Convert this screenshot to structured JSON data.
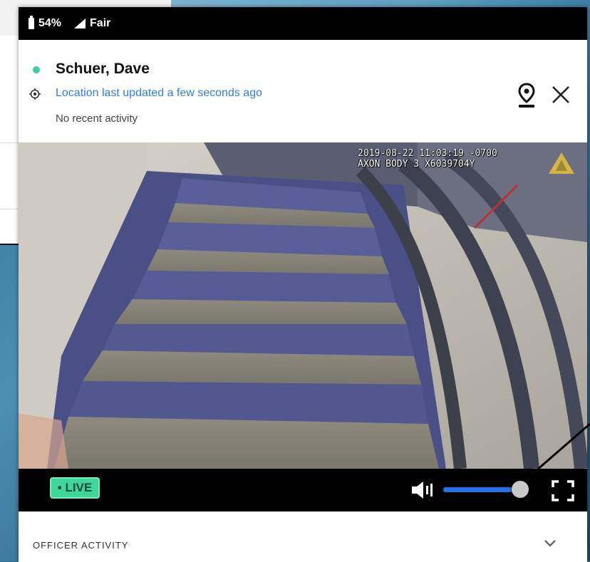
{
  "statusbar": {
    "battery": "54%",
    "signal": "Fair"
  },
  "officer": {
    "name": "Schuer, Dave",
    "location_text": "Location last updated a few seconds ago",
    "activity_text": "No recent activity",
    "status_color": "#3ccf9c"
  },
  "video": {
    "timestamp": "2019-08-22 11:03:19 -0700",
    "device": "AXON BODY 3 X6039704Y"
  },
  "controls": {
    "live_label": "• LIVE",
    "volume_level": 0.85
  },
  "activity_section": {
    "title": "OFFICER ACTIVITY"
  },
  "colors": {
    "accent": "#2273e6",
    "live": "#3fd69b",
    "link": "#2e7fe0"
  },
  "icons": [
    "battery-icon",
    "signal-icon",
    "location-target-icon",
    "map-pin-icon",
    "close-icon",
    "volume-icon",
    "fullscreen-icon",
    "chevron-down-icon"
  ]
}
